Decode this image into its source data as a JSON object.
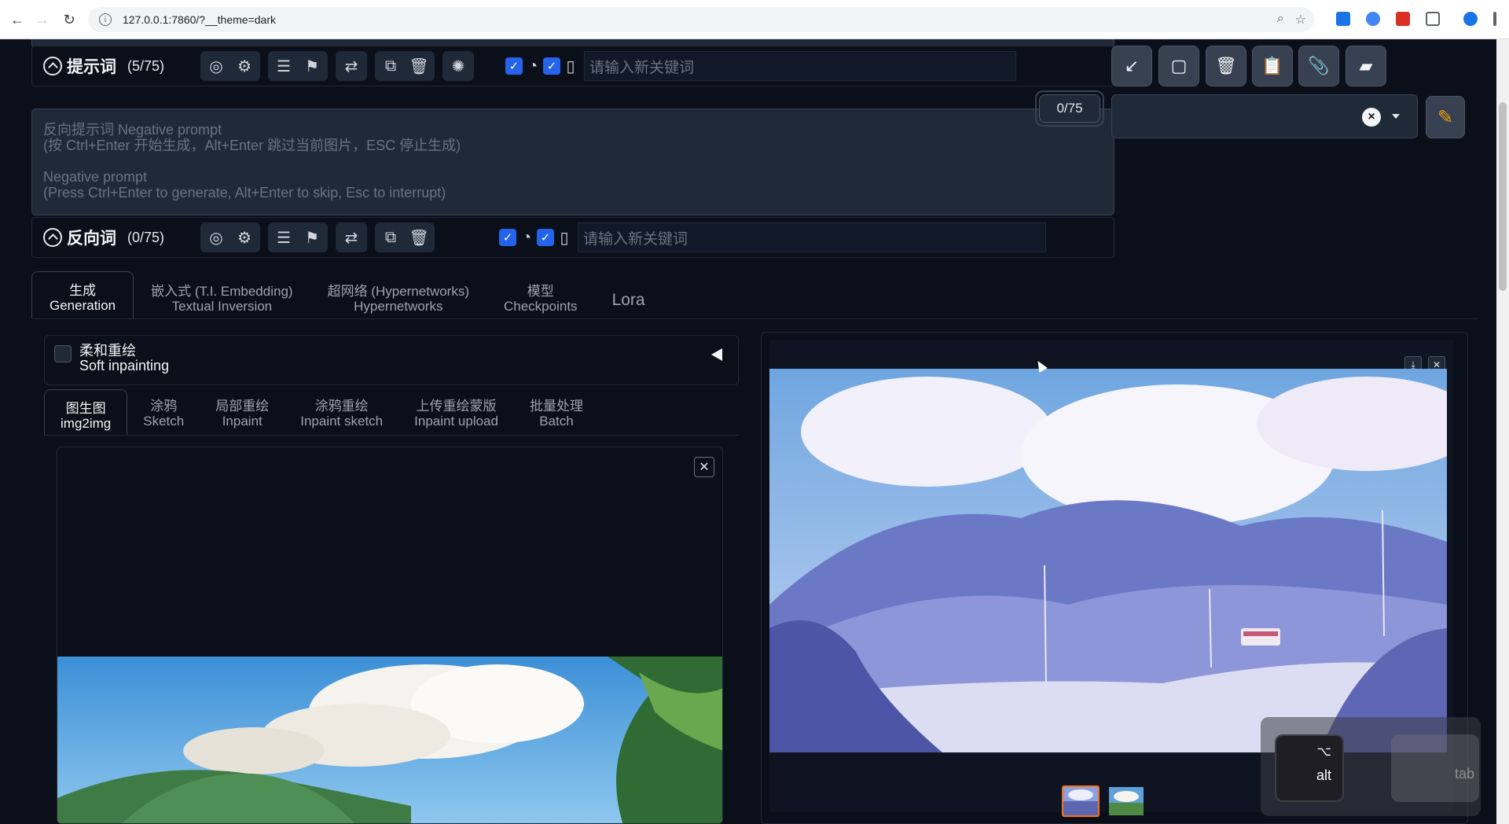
{
  "browser": {
    "url": "127.0.0.1:7860/?__theme=dark"
  },
  "prompt_toolbar": {
    "title": "提示词",
    "count": "(5/75)",
    "keyword_placeholder": "请输入新关键词"
  },
  "negative": {
    "placeholder_line1": "反向提示词 Negative prompt",
    "placeholder_line2": "(按 Ctrl+Enter 开始生成，Alt+Enter 跳过当前图片，ESC 停止生成)",
    "placeholder_line3": "Negative prompt",
    "placeholder_line4": "(Press Ctrl+Enter to generate, Alt+Enter to skip, Esc to interrupt)",
    "token_count": "0/75"
  },
  "negative_toolbar": {
    "title": "反向词",
    "count": "(0/75)",
    "keyword_placeholder": "请输入新关键词"
  },
  "main_tabs": [
    {
      "cn": "生成",
      "en": "Generation"
    },
    {
      "cn": "嵌入式 (T.I. Embedding)",
      "en": "Textual Inversion"
    },
    {
      "cn": "超网络 (Hypernetworks)",
      "en": "Hypernetworks"
    },
    {
      "cn": "模型",
      "en": "Checkpoints"
    },
    {
      "cn": "Lora",
      "en": ""
    }
  ],
  "soft_inpainting": {
    "cn": "柔和重绘",
    "en": "Soft inpainting"
  },
  "sub_tabs": [
    {
      "cn": "图生图",
      "en": "img2img"
    },
    {
      "cn": "涂鸦",
      "en": "Sketch"
    },
    {
      "cn": "局部重绘",
      "en": "Inpaint"
    },
    {
      "cn": "涂鸦重绘",
      "en": "Inpaint sketch"
    },
    {
      "cn": "上传重绘蒙版",
      "en": "Inpaint upload"
    },
    {
      "cn": "批量处理",
      "en": "Batch"
    }
  ],
  "key_overlay": {
    "alt_symbol": "⌥",
    "alt_label": "alt",
    "tab_label": "tab"
  },
  "colors": {
    "background": "#0b0f19",
    "panel": "#1f2937",
    "accent_blue": "#2563eb",
    "accent_orange": "#f97316"
  }
}
